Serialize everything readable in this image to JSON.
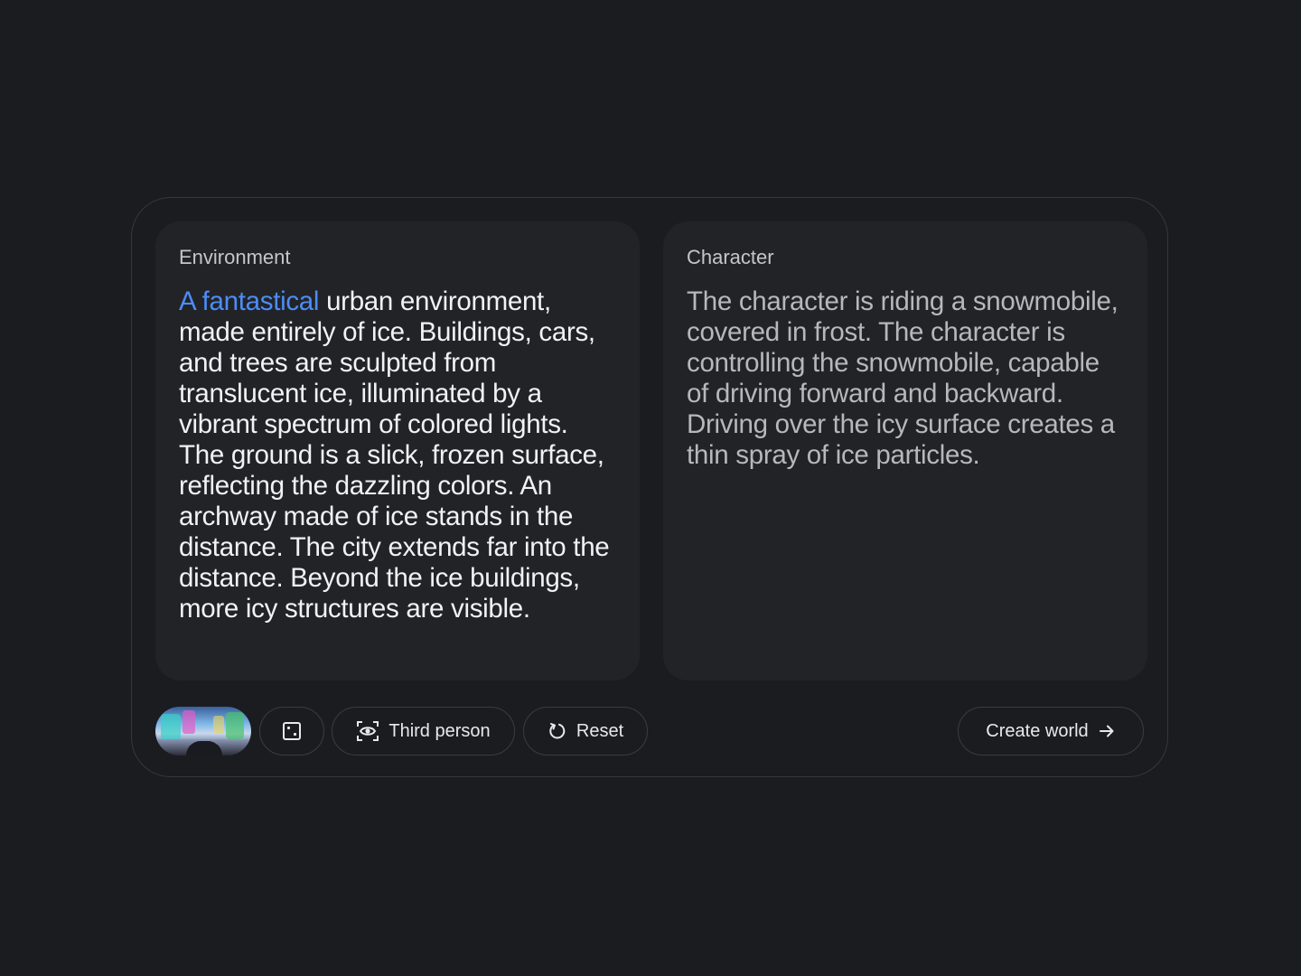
{
  "environment": {
    "label": "Environment",
    "highlight": "A fantastical",
    "text": " urban environment, made entirely of ice. Buildings, cars, and trees are sculpted from translucent ice, illuminated by a vibrant spectrum of colored lights. The ground is a slick, frozen surface, reflecting the dazzling colors. An archway made of ice stands in the distance. The city extends far into the distance. Beyond the ice buildings, more icy structures are visible."
  },
  "character": {
    "label": "Character",
    "text": "The character is riding a snowmobile, covered in frost. The character is controlling the snowmobile, capable of driving forward and backward. Driving over the icy surface creates a thin spray of ice particles."
  },
  "toolbar": {
    "camera_label": "Third person",
    "reset_label": "Reset",
    "create_label": "Create world"
  },
  "icons": {
    "dice": "dice-icon",
    "camera": "eye-focus-icon",
    "reset": "reset-icon",
    "create": "arrow-right-icon"
  },
  "colors": {
    "background": "#1b1c20",
    "panel": "#222327",
    "highlight": "#4c8df6",
    "border": "#3a3c42"
  }
}
